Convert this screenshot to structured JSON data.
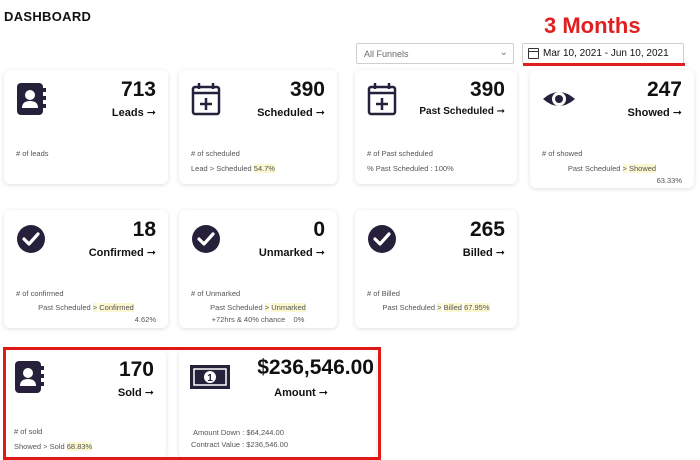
{
  "header": {
    "title": "DASHBOARD"
  },
  "annotation": {
    "period_label": "3 Months",
    "color": "#e02020"
  },
  "filters": {
    "funnel": "All Funnels",
    "date_range": "Mar 10, 2021 - Jun 10, 2021"
  },
  "cards": {
    "leads": {
      "icon": "contact-book-icon",
      "value": "713",
      "label": "Leads",
      "arrow": "➞",
      "sub1": "# of leads"
    },
    "scheduled": {
      "icon": "calendar-plus-icon",
      "value": "390",
      "label": "Scheduled",
      "arrow": "➞",
      "sub1": "# of scheduled",
      "sub2": "Lead > Scheduled",
      "sub2_value": "54.7%"
    },
    "past_scheduled": {
      "icon": "calendar-plus-icon",
      "value": "390",
      "label": "Past Scheduled",
      "arrow": "➞",
      "sub1": "# of Past scheduled",
      "sub2": "% Past Scheduled : 100%"
    },
    "showed": {
      "icon": "eye-icon",
      "value": "247",
      "label": "Showed",
      "arrow": "➞",
      "sub1": "# of showed",
      "sub2a": "Past Scheduled",
      "sub2b": "Showed",
      "sub3": "63.33%"
    },
    "confirmed": {
      "icon": "check-circle-icon",
      "value": "18",
      "label": "Confirmed",
      "arrow": "➞",
      "sub1": "# of confirmed",
      "sub2a": "Past Scheduled",
      "sub2b": "Confirmed",
      "sub3": "4.62%"
    },
    "unmarked": {
      "icon": "check-circle-icon",
      "value": "0",
      "label": "Unmarked",
      "arrow": "➞",
      "sub1": "# of Unmarked",
      "sub2a": "Past Scheduled",
      "sub2b": "Unmarked",
      "sub3": "+72hrs & 40% chance",
      "sub3_value": "0%"
    },
    "billed": {
      "icon": "check-circle-icon",
      "value": "265",
      "label": "Billed",
      "arrow": "➞",
      "sub1": "# of Billed",
      "sub2a": "Past Scheduled",
      "sub2b": "Billed",
      "sub2_value": "67.95%"
    },
    "sold": {
      "icon": "contact-book-icon",
      "value": "170",
      "label": "Sold",
      "arrow": "➞",
      "sub1": "# of sold",
      "sub2": "Showed > Sold",
      "sub2_value": "68.83%"
    },
    "amount": {
      "icon": "banknote-icon",
      "value": "$236,546.00",
      "label": "Amount",
      "arrow": "➞",
      "sub1": "Amount Down : $64,244.00",
      "sub2": "Contract Value : $236,546.00"
    }
  },
  "colors": {
    "icon_dark": "#26203a",
    "highlight": "#fbf7cf",
    "annotation_red": "#e01818"
  }
}
